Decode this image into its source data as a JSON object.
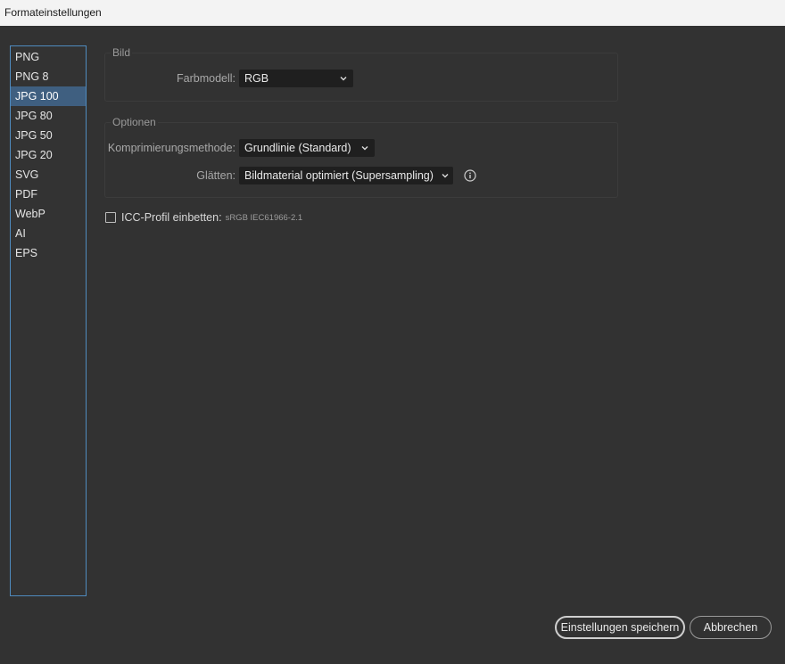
{
  "window": {
    "title": "Formateinstellungen"
  },
  "formats": {
    "items": [
      "PNG",
      "PNG 8",
      "JPG 100",
      "JPG 80",
      "JPG 50",
      "JPG 20",
      "SVG",
      "PDF",
      "WebP",
      "AI",
      "EPS"
    ],
    "selected": "JPG 100"
  },
  "bild": {
    "legend": "Bild",
    "farbmodell_label": "Farbmodell:",
    "farbmodell_value": "RGB"
  },
  "optionen": {
    "legend": "Optionen",
    "kompression_label": "Komprimierungsmethode:",
    "kompression_value": "Grundlinie (Standard)",
    "glaetten_label": "Glätten:",
    "glaetten_value": "Bildmaterial optimiert (Supersampling)",
    "info_icon": "info-icon"
  },
  "icc": {
    "label": "ICC-Profil einbetten:",
    "profile": "sRGB IEC61966-2.1",
    "checked": false
  },
  "buttons": {
    "save": "Einstellungen speichern",
    "cancel": "Abbrechen"
  },
  "colors": {
    "accent": "#4f8bbf",
    "selection": "#3f5f80",
    "background": "#323232"
  }
}
